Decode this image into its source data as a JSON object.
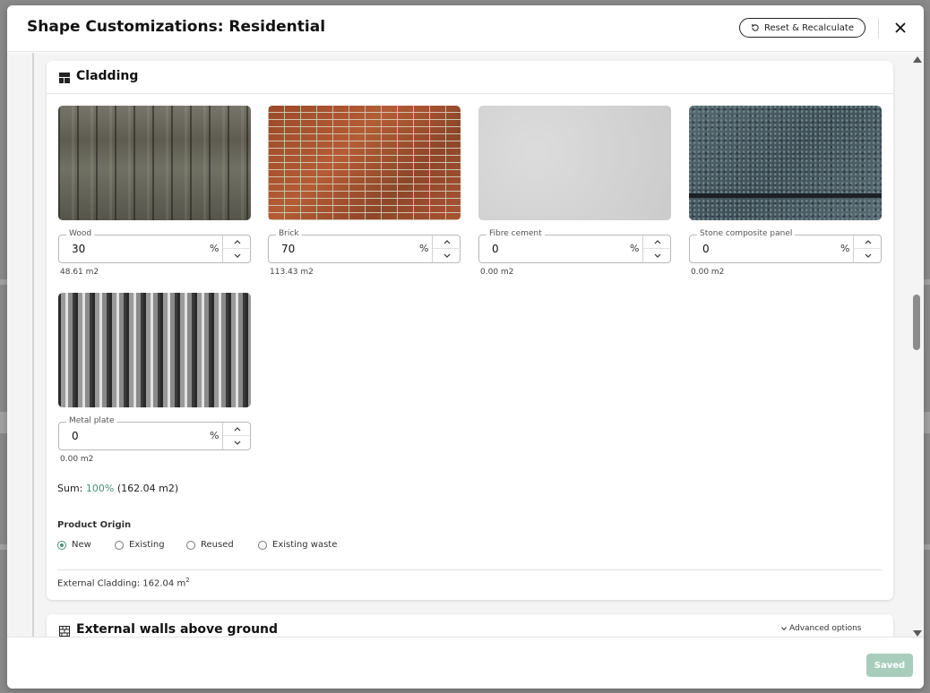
{
  "modal": {
    "title": "Shape Customizations: Residential",
    "reset_label": "Reset & Recalculate",
    "close_icon": "close-icon",
    "saved_label": "Saved"
  },
  "cladding": {
    "title": "Cladding",
    "icon": "grid-icon",
    "materials": [
      {
        "label": "Wood",
        "value": "30",
        "unit": "%",
        "area": "48.61 m2",
        "texture": "wood"
      },
      {
        "label": "Brick",
        "value": "70",
        "unit": "%",
        "area": "113.43 m2",
        "texture": "brick"
      },
      {
        "label": "Fibre cement",
        "value": "0",
        "unit": "%",
        "area": "0.00 m2",
        "texture": "fibre-cement"
      },
      {
        "label": "Stone composite panel",
        "value": "0",
        "unit": "%",
        "area": "0.00 m2",
        "texture": "stone"
      },
      {
        "label": "Metal plate",
        "value": "0",
        "unit": "%",
        "area": "0.00 m2",
        "texture": "metal"
      }
    ],
    "sum_prefix": "Sum:",
    "sum_percent": "100%",
    "sum_area": "(162.04 m2)",
    "product_origin_label": "Product Origin",
    "origin_options": [
      {
        "label": "New",
        "checked": true
      },
      {
        "label": "Existing",
        "checked": false
      },
      {
        "label": "Reused",
        "checked": false
      },
      {
        "label": "Existing waste",
        "checked": false
      }
    ],
    "external_label": "External Cladding:",
    "external_value": "162.04 m",
    "external_unit_sup": "2"
  },
  "external_walls": {
    "title": "External walls above ground",
    "icon": "brick-wall-icon",
    "advanced_label": "Advanced options"
  },
  "colors": {
    "accent": "#4e8f78",
    "saved_button": "#a8cdbd"
  }
}
